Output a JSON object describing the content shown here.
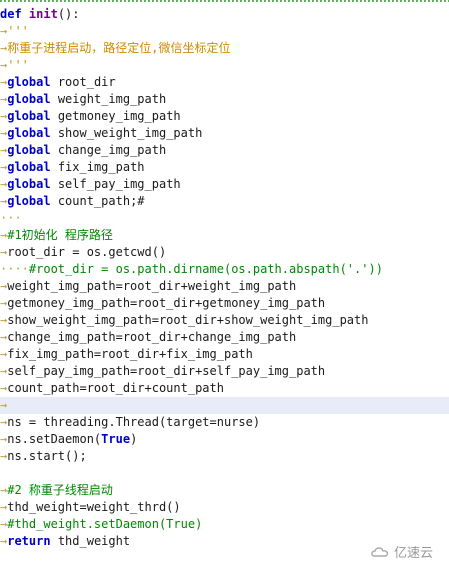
{
  "editor": {
    "lines": [
      [
        {
          "t": "def",
          "c": "kw"
        },
        {
          "t": " "
        },
        {
          "t": "init",
          "c": "fn"
        },
        {
          "t": "():"
        }
      ],
      [
        {
          "t": "→",
          "c": "arrow"
        },
        {
          "t": "'''",
          "c": "str"
        }
      ],
      [
        {
          "t": "→",
          "c": "arrow"
        },
        {
          "t": "称重子进程启动，路径定位,微信坐标定位",
          "c": "str"
        }
      ],
      [
        {
          "t": "→",
          "c": "arrow"
        },
        {
          "t": "'''",
          "c": "str"
        }
      ],
      [
        {
          "t": "→",
          "c": "arrow"
        },
        {
          "t": "global",
          "c": "kw"
        },
        {
          "t": " root_dir"
        }
      ],
      [
        {
          "t": "→",
          "c": "arrow"
        },
        {
          "t": "global",
          "c": "kw"
        },
        {
          "t": " weight_img_path"
        }
      ],
      [
        {
          "t": "→",
          "c": "arrow"
        },
        {
          "t": "global",
          "c": "kw"
        },
        {
          "t": " getmoney_img_path"
        }
      ],
      [
        {
          "t": "→",
          "c": "arrow"
        },
        {
          "t": "global",
          "c": "kw"
        },
        {
          "t": " show_weight_img_path"
        }
      ],
      [
        {
          "t": "→",
          "c": "arrow"
        },
        {
          "t": "global",
          "c": "kw"
        },
        {
          "t": " change_img_path"
        }
      ],
      [
        {
          "t": "→",
          "c": "arrow"
        },
        {
          "t": "global",
          "c": "kw"
        },
        {
          "t": " fix_img_path"
        }
      ],
      [
        {
          "t": "→",
          "c": "arrow"
        },
        {
          "t": "global",
          "c": "kw"
        },
        {
          "t": " self_pay_img_path"
        }
      ],
      [
        {
          "t": "→",
          "c": "arrow"
        },
        {
          "t": "global",
          "c": "kw"
        },
        {
          "t": " count_path;#"
        }
      ],
      [
        {
          "t": "···",
          "c": "arrow"
        }
      ],
      [
        {
          "t": "→",
          "c": "arrow"
        },
        {
          "t": "#1初始化 程序路径",
          "c": "cmt"
        }
      ],
      [
        {
          "t": "→",
          "c": "arrow"
        },
        {
          "t": "root_dir = os.getcwd()"
        }
      ],
      [
        {
          "t": "····",
          "c": "arrow"
        },
        {
          "t": "#root_dir = os.path.dirname(os.path.abspath('.'))",
          "c": "cmt"
        }
      ],
      [
        {
          "t": "→",
          "c": "arrow"
        },
        {
          "t": "weight_img_path=root_dir+weight_img_path"
        }
      ],
      [
        {
          "t": "→",
          "c": "arrow"
        },
        {
          "t": "getmoney_img_path=root_dir+getmoney_img_path"
        }
      ],
      [
        {
          "t": "→",
          "c": "arrow"
        },
        {
          "t": "show_weight_img_path=root_dir+show_weight_img_path"
        }
      ],
      [
        {
          "t": "→",
          "c": "arrow"
        },
        {
          "t": "change_img_path=root_dir+change_img_path"
        }
      ],
      [
        {
          "t": "→",
          "c": "arrow"
        },
        {
          "t": "fix_img_path=root_dir+fix_img_path"
        }
      ],
      [
        {
          "t": "→",
          "c": "arrow"
        },
        {
          "t": "self_pay_img_path=root_dir+self_pay_img_path"
        }
      ],
      [
        {
          "t": "→",
          "c": "arrow"
        },
        {
          "t": "count_path=root_dir+count_path"
        }
      ],
      [
        {
          "t": "→",
          "c": "arrow"
        }
      ],
      [
        {
          "t": "→",
          "c": "arrow"
        },
        {
          "t": "ns = threading.Thread(target=nurse)"
        }
      ],
      [
        {
          "t": "→",
          "c": "arrow"
        },
        {
          "t": "ns.setDaemon("
        },
        {
          "t": "True",
          "c": "kw"
        },
        {
          "t": ")"
        }
      ],
      [
        {
          "t": "→",
          "c": "arrow"
        },
        {
          "t": "ns.start();"
        }
      ],
      [],
      [
        {
          "t": "→",
          "c": "arrow"
        },
        {
          "t": "#2 称重子线程启动",
          "c": "cmt"
        }
      ],
      [
        {
          "t": "→",
          "c": "arrow"
        },
        {
          "t": "thd_weight=weight_thrd()"
        }
      ],
      [
        {
          "t": "→",
          "c": "arrow"
        },
        {
          "t": "#thd_weight.setDaemon(True)",
          "c": "cmt"
        }
      ],
      [
        {
          "t": "→",
          "c": "arrow"
        },
        {
          "t": "return",
          "c": "kw"
        },
        {
          "t": " thd_weight"
        }
      ]
    ],
    "highlighted_line": 23
  },
  "watermark": {
    "text": "亿速云"
  }
}
